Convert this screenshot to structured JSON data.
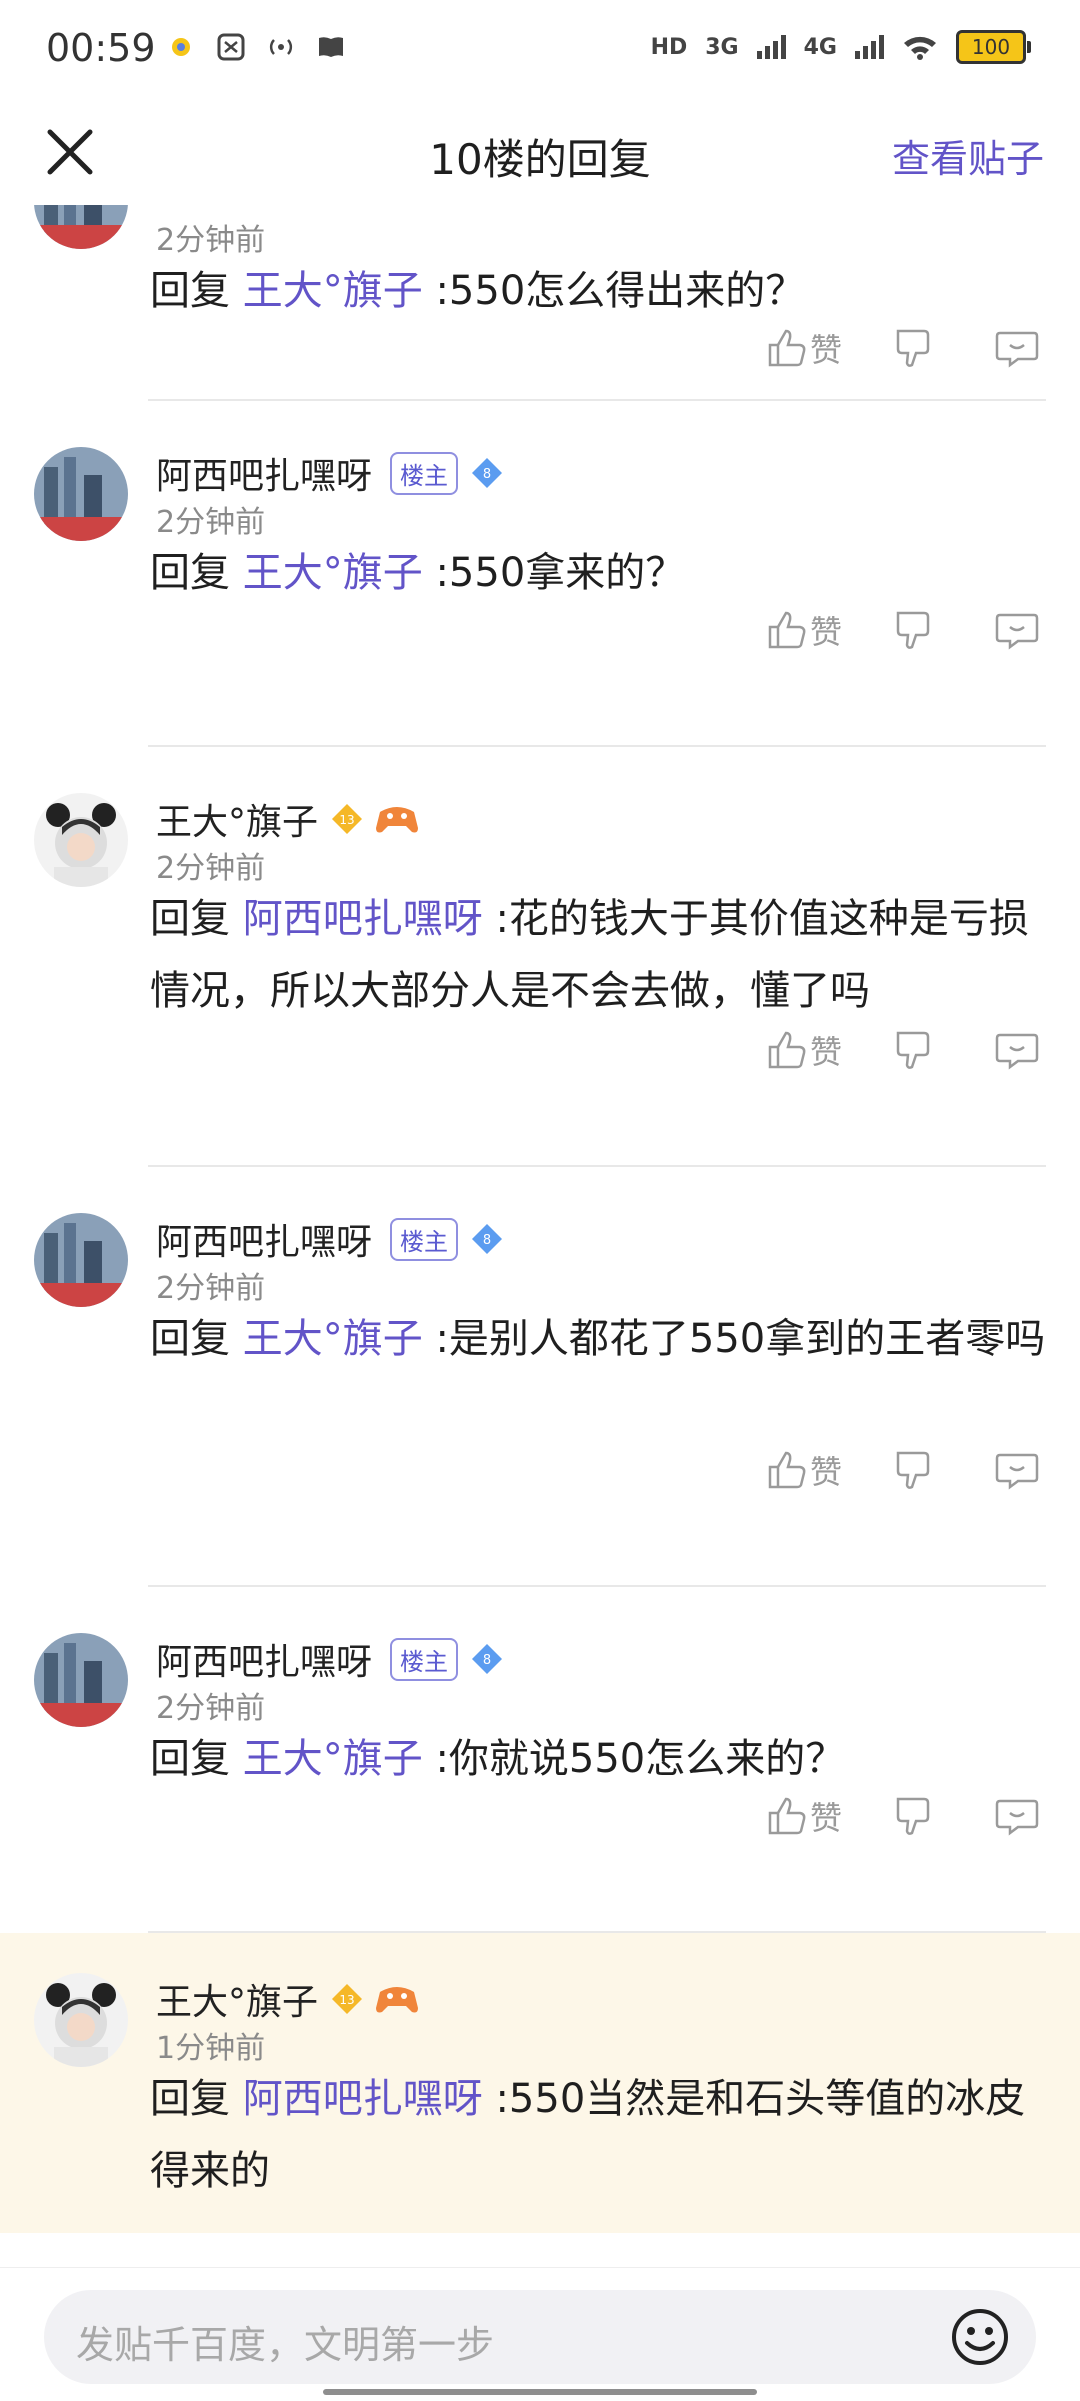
{
  "status_bar": {
    "time": "00:59",
    "hd": "HD",
    "net1": "3G",
    "net2": "4G",
    "battery": "100"
  },
  "header": {
    "title": "10楼的回复",
    "view_post": "查看贴子"
  },
  "action_labels": {
    "like": "赞"
  },
  "replies": [
    {
      "user": "",
      "time": "2分钟前",
      "prefix": "回复",
      "mention": "王大°旗子",
      "text": " :550怎么得出来的？"
    },
    {
      "user": "阿西吧扎嘿呀",
      "owner_badge": "楼主",
      "level": "8",
      "time": "2分钟前",
      "prefix": "回复",
      "mention": "王大°旗子",
      "text": " :550拿来的？"
    },
    {
      "user": "王大°旗子",
      "level": "13",
      "time": "2分钟前",
      "prefix": "回复",
      "mention": "阿西吧扎嘿呀",
      "text": " :花的钱大于其价值这种是亏损情况，所以大部分人是不会去做，懂了吗"
    },
    {
      "user": "阿西吧扎嘿呀",
      "owner_badge": "楼主",
      "level": "8",
      "time": "2分钟前",
      "prefix": "回复",
      "mention": "王大°旗子",
      "text": " :是别人都花了550拿到的王者零吗"
    },
    {
      "user": "阿西吧扎嘿呀",
      "owner_badge": "楼主",
      "level": "8",
      "time": "2分钟前",
      "prefix": "回复",
      "mention": "王大°旗子",
      "text": " :你就说550怎么来的？"
    },
    {
      "user": "王大°旗子",
      "level": "13",
      "time": "1分钟前",
      "prefix": "回复",
      "mention": "阿西吧扎嘿呀",
      "text": " :550当然是和石头等值的冰皮得来的"
    }
  ],
  "input": {
    "placeholder": "发贴千百度，文明第一步"
  },
  "colors": {
    "accent": "#6254c8",
    "highlight_bg": "#fdf7e8"
  }
}
